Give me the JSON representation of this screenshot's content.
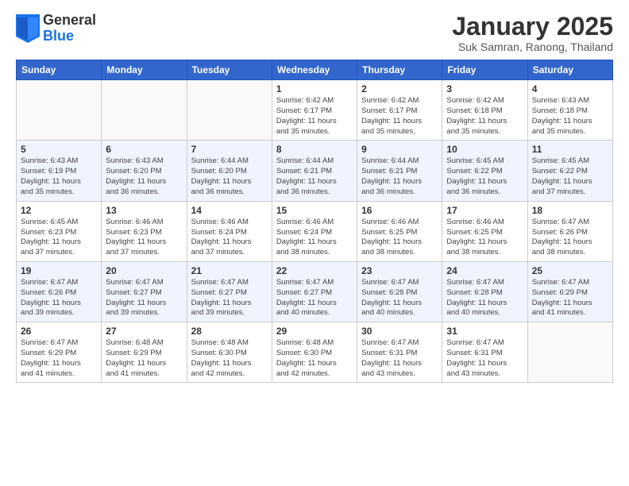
{
  "logo": {
    "general": "General",
    "blue": "Blue"
  },
  "title": "January 2025",
  "subtitle": "Suk Samran, Ranong, Thailand",
  "headers": [
    "Sunday",
    "Monday",
    "Tuesday",
    "Wednesday",
    "Thursday",
    "Friday",
    "Saturday"
  ],
  "weeks": [
    [
      {
        "day": "",
        "info": ""
      },
      {
        "day": "",
        "info": ""
      },
      {
        "day": "",
        "info": ""
      },
      {
        "day": "1",
        "info": "Sunrise: 6:42 AM\nSunset: 6:17 PM\nDaylight: 11 hours\nand 35 minutes."
      },
      {
        "day": "2",
        "info": "Sunrise: 6:42 AM\nSunset: 6:17 PM\nDaylight: 11 hours\nand 35 minutes."
      },
      {
        "day": "3",
        "info": "Sunrise: 6:42 AM\nSunset: 6:18 PM\nDaylight: 11 hours\nand 35 minutes."
      },
      {
        "day": "4",
        "info": "Sunrise: 6:43 AM\nSunset: 6:18 PM\nDaylight: 11 hours\nand 35 minutes."
      }
    ],
    [
      {
        "day": "5",
        "info": "Sunrise: 6:43 AM\nSunset: 6:19 PM\nDaylight: 11 hours\nand 35 minutes."
      },
      {
        "day": "6",
        "info": "Sunrise: 6:43 AM\nSunset: 6:20 PM\nDaylight: 11 hours\nand 36 minutes."
      },
      {
        "day": "7",
        "info": "Sunrise: 6:44 AM\nSunset: 6:20 PM\nDaylight: 11 hours\nand 36 minutes."
      },
      {
        "day": "8",
        "info": "Sunrise: 6:44 AM\nSunset: 6:21 PM\nDaylight: 11 hours\nand 36 minutes."
      },
      {
        "day": "9",
        "info": "Sunrise: 6:44 AM\nSunset: 6:21 PM\nDaylight: 11 hours\nand 36 minutes."
      },
      {
        "day": "10",
        "info": "Sunrise: 6:45 AM\nSunset: 6:22 PM\nDaylight: 11 hours\nand 36 minutes."
      },
      {
        "day": "11",
        "info": "Sunrise: 6:45 AM\nSunset: 6:22 PM\nDaylight: 11 hours\nand 37 minutes."
      }
    ],
    [
      {
        "day": "12",
        "info": "Sunrise: 6:45 AM\nSunset: 6:23 PM\nDaylight: 11 hours\nand 37 minutes."
      },
      {
        "day": "13",
        "info": "Sunrise: 6:46 AM\nSunset: 6:23 PM\nDaylight: 11 hours\nand 37 minutes."
      },
      {
        "day": "14",
        "info": "Sunrise: 6:46 AM\nSunset: 6:24 PM\nDaylight: 11 hours\nand 37 minutes."
      },
      {
        "day": "15",
        "info": "Sunrise: 6:46 AM\nSunset: 6:24 PM\nDaylight: 11 hours\nand 38 minutes."
      },
      {
        "day": "16",
        "info": "Sunrise: 6:46 AM\nSunset: 6:25 PM\nDaylight: 11 hours\nand 38 minutes."
      },
      {
        "day": "17",
        "info": "Sunrise: 6:46 AM\nSunset: 6:25 PM\nDaylight: 11 hours\nand 38 minutes."
      },
      {
        "day": "18",
        "info": "Sunrise: 6:47 AM\nSunset: 6:26 PM\nDaylight: 11 hours\nand 38 minutes."
      }
    ],
    [
      {
        "day": "19",
        "info": "Sunrise: 6:47 AM\nSunset: 6:26 PM\nDaylight: 11 hours\nand 39 minutes."
      },
      {
        "day": "20",
        "info": "Sunrise: 6:47 AM\nSunset: 6:27 PM\nDaylight: 11 hours\nand 39 minutes."
      },
      {
        "day": "21",
        "info": "Sunrise: 6:47 AM\nSunset: 6:27 PM\nDaylight: 11 hours\nand 39 minutes."
      },
      {
        "day": "22",
        "info": "Sunrise: 6:47 AM\nSunset: 6:27 PM\nDaylight: 11 hours\nand 40 minutes."
      },
      {
        "day": "23",
        "info": "Sunrise: 6:47 AM\nSunset: 6:28 PM\nDaylight: 11 hours\nand 40 minutes."
      },
      {
        "day": "24",
        "info": "Sunrise: 6:47 AM\nSunset: 6:28 PM\nDaylight: 11 hours\nand 40 minutes."
      },
      {
        "day": "25",
        "info": "Sunrise: 6:47 AM\nSunset: 6:29 PM\nDaylight: 11 hours\nand 41 minutes."
      }
    ],
    [
      {
        "day": "26",
        "info": "Sunrise: 6:47 AM\nSunset: 6:29 PM\nDaylight: 11 hours\nand 41 minutes."
      },
      {
        "day": "27",
        "info": "Sunrise: 6:48 AM\nSunset: 6:29 PM\nDaylight: 11 hours\nand 41 minutes."
      },
      {
        "day": "28",
        "info": "Sunrise: 6:48 AM\nSunset: 6:30 PM\nDaylight: 11 hours\nand 42 minutes."
      },
      {
        "day": "29",
        "info": "Sunrise: 6:48 AM\nSunset: 6:30 PM\nDaylight: 11 hours\nand 42 minutes."
      },
      {
        "day": "30",
        "info": "Sunrise: 6:47 AM\nSunset: 6:31 PM\nDaylight: 11 hours\nand 43 minutes."
      },
      {
        "day": "31",
        "info": "Sunrise: 6:47 AM\nSunset: 6:31 PM\nDaylight: 11 hours\nand 43 minutes."
      },
      {
        "day": "",
        "info": ""
      }
    ]
  ]
}
